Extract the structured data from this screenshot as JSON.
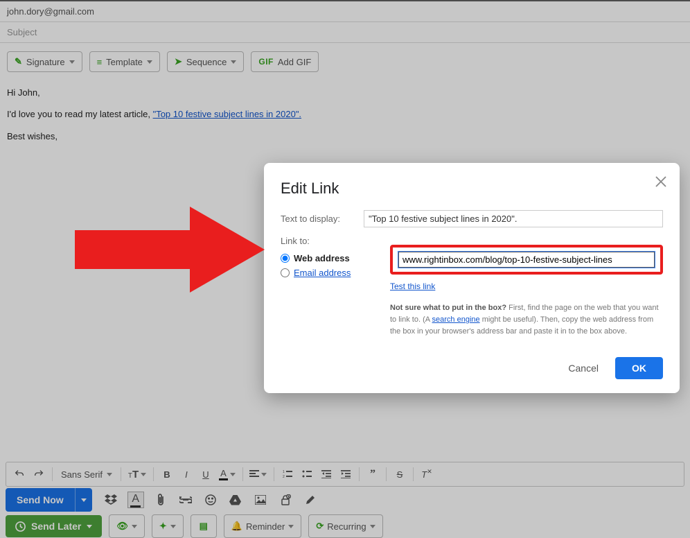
{
  "compose": {
    "to": "john.dory@gmail.com",
    "subject_placeholder": "Subject",
    "toolbar": {
      "signature": "Signature",
      "template": "Template",
      "sequence": "Sequence",
      "addgif": "Add GIF"
    },
    "body": {
      "greeting": "Hi John,",
      "line1_part1": "I'd love you to read my latest article, ",
      "line1_link": "\"Top 10 festive subject lines in 2020\".",
      "closing": "Best wishes,"
    }
  },
  "formatbar": {
    "font": "Sans Serif"
  },
  "send": {
    "now": "Send Now",
    "later": "Send Later",
    "reminder": "Reminder",
    "recurring": "Recurring"
  },
  "dialog": {
    "title": "Edit Link",
    "text_to_display_label": "Text to display:",
    "text_to_display_value": "\"Top 10 festive subject lines in 2020\".",
    "link_to_label": "Link to:",
    "radio_web": "Web address",
    "radio_email": "Email address",
    "url_value": "www.rightinbox.com/blog/top-10-festive-subject-lines",
    "test_link": "Test this link",
    "hint_bold": "Not sure what to put in the box?",
    "hint_1": " First, find the page on the web that you want to link to. (A ",
    "hint_link": "search engine",
    "hint_2": " might be useful). Then, copy the web address from the box in your browser's address bar and paste it in to the box above.",
    "cancel": "Cancel",
    "ok": "OK"
  }
}
